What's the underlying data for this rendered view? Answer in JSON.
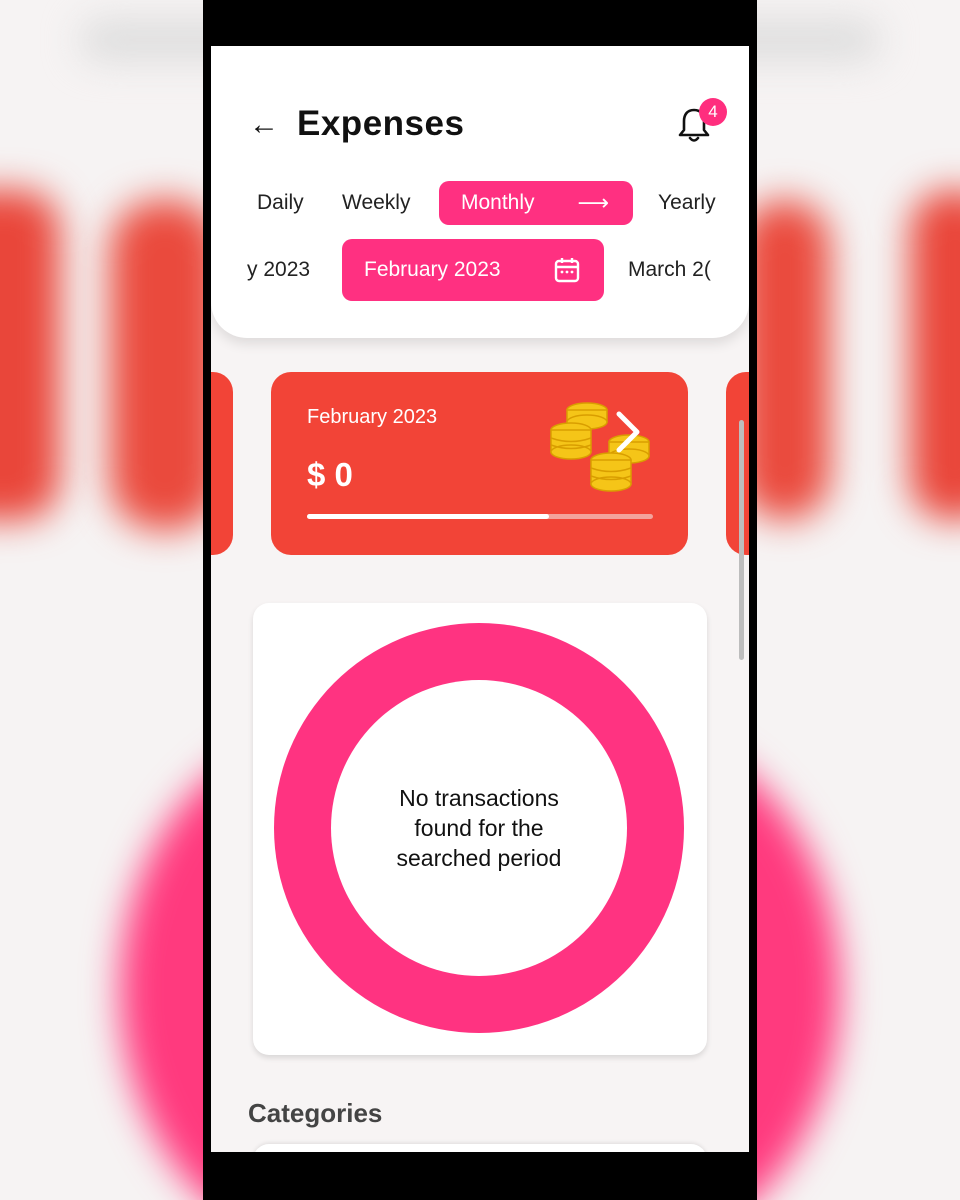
{
  "header": {
    "title": "Expenses",
    "notification_count": "4"
  },
  "periods": {
    "items": [
      "Daily",
      "Weekly",
      "Monthly",
      "Yearly"
    ],
    "selected": "Monthly"
  },
  "months": {
    "prev": "y 2023",
    "selected": "February 2023",
    "next": "March 2("
  },
  "summary": {
    "month": "February 2023",
    "amount": "$ 0",
    "progress_fraction": 0.7
  },
  "chart": {
    "empty_message": "No transactions found for the searched period"
  },
  "categories": {
    "title": "Categories"
  },
  "colors": {
    "accent": "#ff3081",
    "card": "#f24437",
    "coins": "#f5c518"
  }
}
